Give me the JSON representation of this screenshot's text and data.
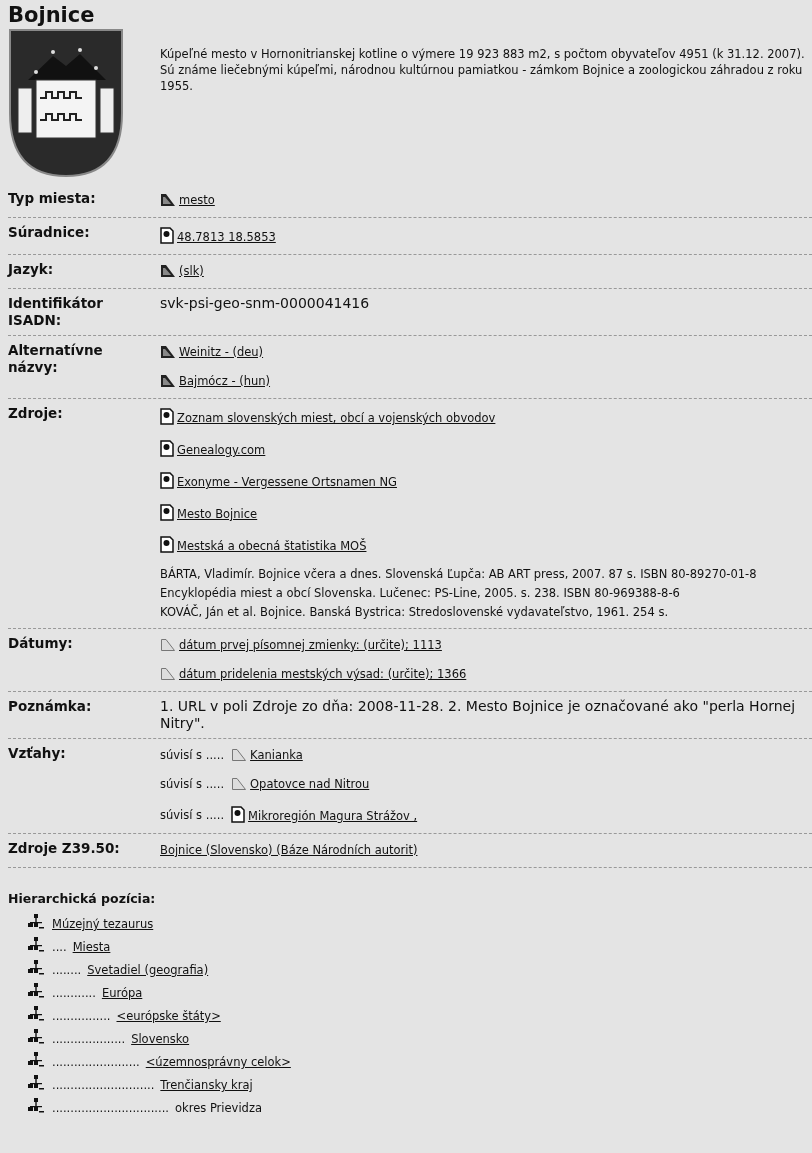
{
  "title": "Bojnice",
  "description": "Kúpeľné mesto v Hornonitrianskej kotline o výmere 19 923 883 m2, s počtom obyvateľov 4951 (k 31.12. 2007). Sú známe liečebnými kúpeľmi, národnou kultúrnou pamiatkou - zámkom Bojnice a zoologickou záhradou z roku 1955.",
  "fields": [
    {
      "label": "Typ miesta:",
      "items": [
        {
          "kind": "place",
          "text": "mesto"
        }
      ]
    },
    {
      "label": "Súradnice:",
      "items": [
        {
          "kind": "doc",
          "text": " 48.7813 18.5853"
        }
      ]
    },
    {
      "label": "Jazyk:",
      "items": [
        {
          "kind": "place",
          "text": "(slk)"
        }
      ]
    },
    {
      "label": "Identifikátor ISADN:",
      "items": [
        {
          "kind": "note",
          "text": "svk-psi-geo-snm-0000041416"
        }
      ]
    },
    {
      "label": "Alternatívne názvy:",
      "items": [
        {
          "kind": "place",
          "text": "Weinitz - (deu)"
        },
        {
          "kind": "place",
          "text": "Bajmócz - (hun)"
        }
      ]
    },
    {
      "label": "Zdroje:",
      "items": [
        {
          "kind": "doc",
          "text": "Zoznam slovenských miest, obcí a vojenských obvodov"
        },
        {
          "kind": "doc",
          "text": "Genealogy.com"
        },
        {
          "kind": "doc",
          "text": "Exonyme - Vergessene Ortsnamen NG"
        },
        {
          "kind": "doc",
          "text": "Mesto Bojnice"
        },
        {
          "kind": "doc",
          "text": "Mestská a obecná štatistika MOŠ"
        },
        {
          "kind": "citation",
          "text": "BÁRTA, Vladimír. Bojnice včera a dnes. Slovenská Ľupča: AB ART press, 2007. 87 s. ISBN 80-89270-01-8"
        },
        {
          "kind": "citation",
          "text": "Encyklopédia miest a obcí Slovenska. Lučenec: PS-Line, 2005. s. 238. ISBN 80-969388-8-6"
        },
        {
          "kind": "citation",
          "text": "KOVÁČ, Ján et al. Bojnice. Banská Bystrica: Stredoslovenské vydavateľstvo, 1961. 254 s."
        }
      ]
    },
    {
      "label": "Dátumy:",
      "items": [
        {
          "kind": "date",
          "text": "dátum prvej písomnej zmienky: (určite); 1113"
        },
        {
          "kind": "date",
          "text": "dátum pridelenia mestských výsad: (určite); 1366"
        }
      ]
    },
    {
      "label": "Poznámka:",
      "items": [
        {
          "kind": "note",
          "text": "1. URL v poli Zdroje zo dňa: 2008-11-28. 2. Mesto Bojnice je označované ako \"perla Hornej Nitry\"."
        }
      ]
    },
    {
      "label": "Vzťahy:",
      "items": [
        {
          "kind": "date",
          "prefix": "súvisí s .....",
          "text": "Kanianka"
        },
        {
          "kind": "date",
          "prefix": "súvisí s .....",
          "text": "Opatovce nad Nitrou"
        },
        {
          "kind": "doc",
          "prefix": "súvisí s .....",
          "text": "Mikroregión Magura Strážov ,"
        }
      ]
    },
    {
      "label": "Zdroje Z39.50:",
      "items": [
        {
          "kind": "plain",
          "text": "Bojnice (Slovensko) (Báze Národních autorit)"
        }
      ]
    }
  ],
  "hierarchy": {
    "title": "Hierarchická pozícia:",
    "items": [
      {
        "text": "Múzejný tezaurus",
        "link": true,
        "children": [
          {
            "leader": "....",
            "text": "Miesta",
            "link": true,
            "children": [
              {
                "leader": "........",
                "text": "Svetadiel (geografia)",
                "link": true,
                "children": [
                  {
                    "leader": "............",
                    "text": "Európa",
                    "link": true,
                    "children": [
                      {
                        "leader": "................",
                        "text": "<európske štáty>",
                        "link": true,
                        "children": [
                          {
                            "leader": "....................",
                            "text": "Slovensko",
                            "link": true,
                            "children": [
                              {
                                "leader": "........................",
                                "text": "<územnosprávny celok>",
                                "link": true,
                                "children": [
                                  {
                                    "leader": "............................",
                                    "text": "Trenčiansky kraj",
                                    "link": true,
                                    "children": [
                                      {
                                        "leader": "................................",
                                        "text": "okres Prievidza",
                                        "link": false
                                      }
                                    ]
                                  }
                                ]
                              }
                            ]
                          }
                        ]
                      }
                    ]
                  }
                ]
              }
            ]
          }
        ]
      }
    ]
  }
}
